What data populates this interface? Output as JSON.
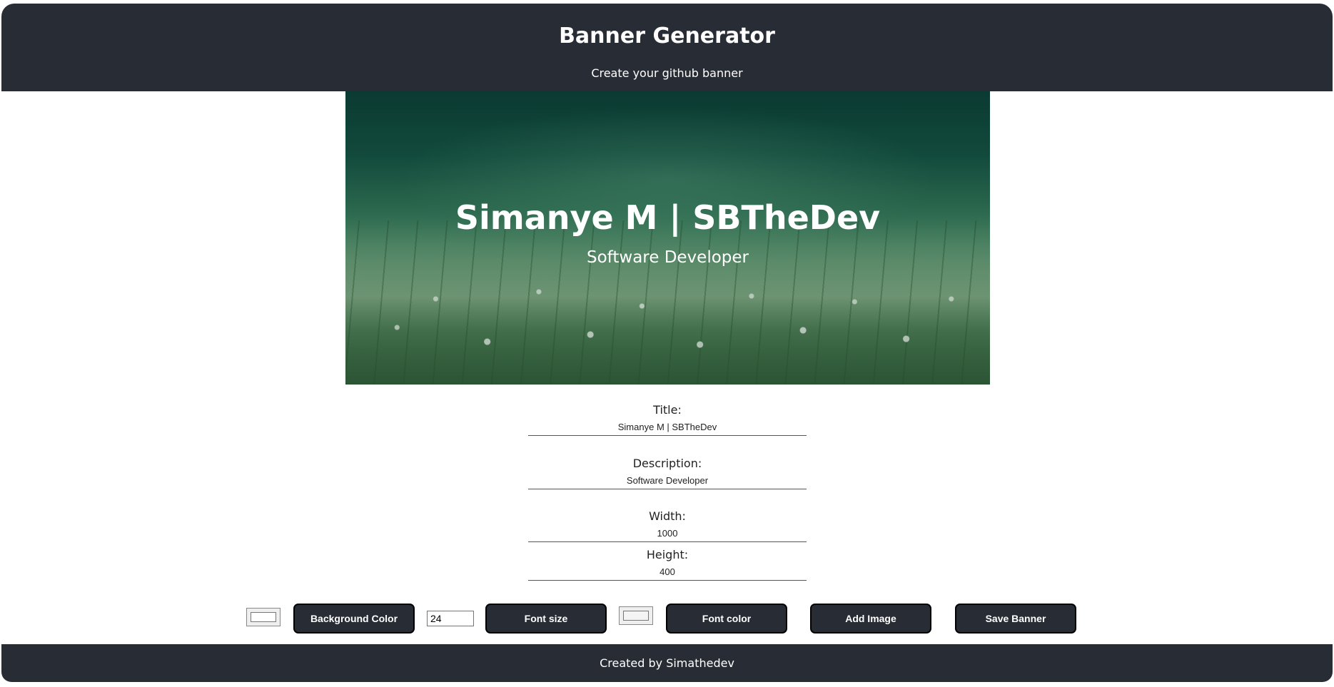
{
  "header": {
    "title": "Banner Generator",
    "subtitle": "Create your github banner"
  },
  "banner": {
    "title": "Simanye M | SBTheDev",
    "description": "Software Developer",
    "background_image": "green meadow with white flowers"
  },
  "form": {
    "title_label": "Title:",
    "title_value": "Simanye M | SBTheDev",
    "description_label": "Description:",
    "description_value": "Software Developer",
    "width_label": "Width:",
    "width_value": "1000",
    "height_label": "Height:",
    "height_value": "400"
  },
  "controls": {
    "background_color_label": "Background Color",
    "font_size_value": "24",
    "font_size_label": "Font size",
    "font_color_label": "Font color",
    "add_image_label": "Add Image",
    "save_banner_label": "Save Banner"
  },
  "footer": {
    "text": "Created by Simathedev"
  },
  "colors": {
    "dark": "#282c34",
    "white": "#ffffff"
  }
}
